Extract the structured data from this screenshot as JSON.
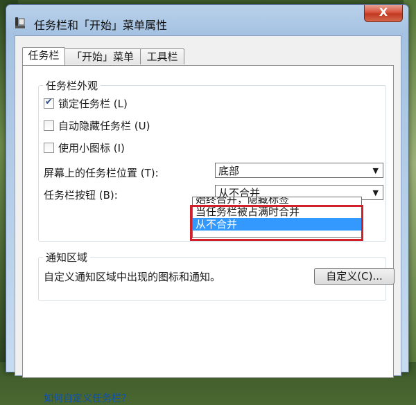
{
  "window": {
    "title": "任务栏和「开始」菜单属性",
    "close_label": "X"
  },
  "tabs": [
    {
      "label": "任务栏"
    },
    {
      "label": "「开始」菜单"
    },
    {
      "label": "工具栏"
    }
  ],
  "appearance": {
    "title": "任务栏外观",
    "lock_taskbar": {
      "label": "锁定任务栏 (L)",
      "checked": true
    },
    "auto_hide": {
      "label": "自动隐藏任务栏 (U)",
      "checked": false
    },
    "small_icons": {
      "label": "使用小图标 (I)",
      "checked": false
    },
    "location_label": "屏幕上的任务栏位置 (T):",
    "location_value": "底部",
    "buttons_label": "任务栏按钮 (B):",
    "buttons_value": "从不合并",
    "buttons_options": [
      "始终合并，隐藏标签",
      "当任务栏被占满时合并",
      "从不合并"
    ],
    "buttons_selected_index": 2
  },
  "notification": {
    "title": "通知区域",
    "text": "自定义通知区域中出现的图标和通知。",
    "customize_button": "自定义(C)..."
  },
  "footer_link": "如何自定义任务栏？"
}
